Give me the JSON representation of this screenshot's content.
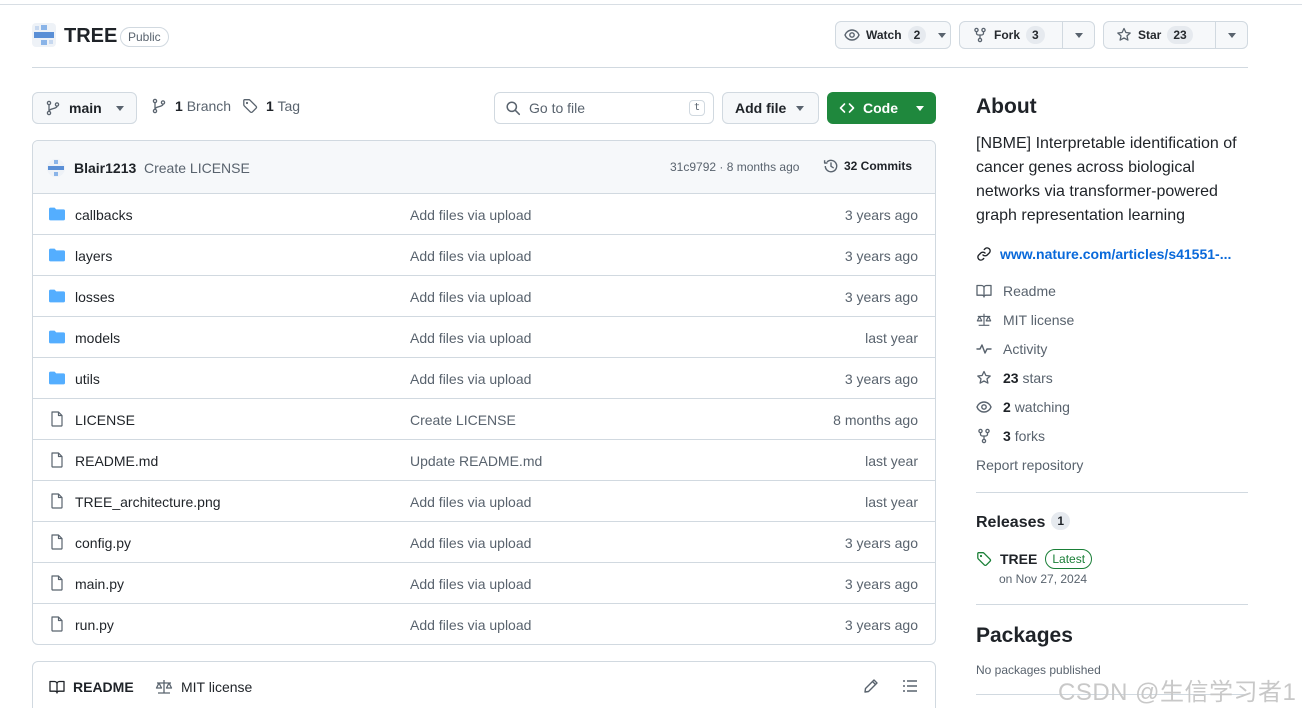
{
  "repo": {
    "name": "TREE",
    "visibility": "Public",
    "watch": {
      "label": "Watch",
      "count": "2"
    },
    "fork": {
      "label": "Fork",
      "count": "3"
    },
    "star": {
      "label": "Star",
      "count": "23"
    }
  },
  "branch_bar": {
    "branch": "main",
    "branch_count": "1",
    "branch_label": "Branch",
    "tag_count": "1",
    "tag_label": "Tag",
    "goto_placeholder": "Go to file",
    "goto_kbd": "t",
    "add_file": "Add file",
    "code": "Code"
  },
  "latest_commit": {
    "user": "Blair1213",
    "message": "Create LICENSE",
    "meta": "31c9792 · 8 months ago",
    "commits": "32 Commits"
  },
  "files": [
    {
      "name": "callbacks",
      "type": "folder",
      "message": "Add files via upload",
      "age": "3 years ago"
    },
    {
      "name": "layers",
      "type": "folder",
      "message": "Add files via upload",
      "age": "3 years ago"
    },
    {
      "name": "losses",
      "type": "folder",
      "message": "Add files via upload",
      "age": "3 years ago"
    },
    {
      "name": "models",
      "type": "folder",
      "message": "Add files via upload",
      "age": "last year"
    },
    {
      "name": "utils",
      "type": "folder",
      "message": "Add files via upload",
      "age": "3 years ago"
    },
    {
      "name": "LICENSE",
      "type": "file",
      "message": "Create LICENSE",
      "age": "8 months ago"
    },
    {
      "name": "README.md",
      "type": "file",
      "message": "Update README.md",
      "age": "last year"
    },
    {
      "name": "TREE_architecture.png",
      "type": "file",
      "message": "Add files via upload",
      "age": "last year"
    },
    {
      "name": "config.py",
      "type": "file",
      "message": "Add files via upload",
      "age": "3 years ago"
    },
    {
      "name": "main.py",
      "type": "file",
      "message": "Add files via upload",
      "age": "3 years ago"
    },
    {
      "name": "run.py",
      "type": "file",
      "message": "Add files via upload",
      "age": "3 years ago"
    }
  ],
  "readme_bar": {
    "readme": "README",
    "license": "MIT license"
  },
  "about": {
    "title": "About",
    "description": "[NBME] Interpretable identification of cancer genes across biological networks via transformer-powered graph representation learning",
    "link": "www.nature.com/articles/s41551-...",
    "readme": "Readme",
    "license": "MIT license",
    "activity": "Activity",
    "stars_count": "23",
    "stars_label": "stars",
    "watching_count": "2",
    "watching_label": "watching",
    "forks_count": "3",
    "forks_label": "forks",
    "report": "Report repository"
  },
  "releases": {
    "title": "Releases",
    "count": "1",
    "name": "TREE",
    "badge": "Latest",
    "date": "on Nov 27, 2024"
  },
  "packages": {
    "title": "Packages",
    "empty": "No packages published"
  },
  "watermark": "CSDN @生信学习者1",
  "colors": {
    "accent": "#0969da",
    "code_button": "#1f883d",
    "folder": "#54aeff",
    "border": "#d1d9e0"
  }
}
